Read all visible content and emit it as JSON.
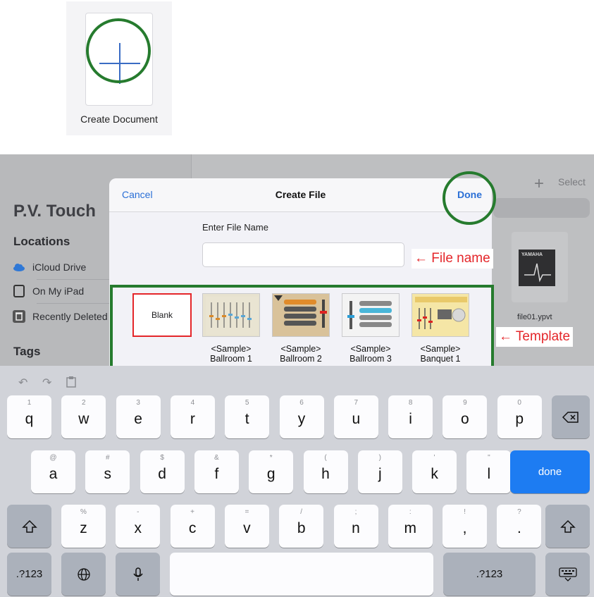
{
  "tile": {
    "label": "Create Document"
  },
  "background": {
    "app_title": "P.V. Touch",
    "locations_heading": "Locations",
    "locations": [
      "iCloud Drive",
      "On My iPad",
      "Recently Deleted"
    ],
    "tags_heading": "Tags",
    "select_label": "Select",
    "file_name": "file01.ypvt",
    "file_brand": "YAMAHA"
  },
  "dialog": {
    "cancel": "Cancel",
    "title": "Create File",
    "done": "Done",
    "field_label": "Enter File Name",
    "field_value": "",
    "templates": [
      {
        "name": "Blank"
      },
      {
        "name": "<Sample>\nBallroom 1"
      },
      {
        "name": "<Sample>\nBallroom 2"
      },
      {
        "name": "<Sample>\nBallroom 3"
      },
      {
        "name": "<Sample>\nBanquet 1"
      }
    ]
  },
  "annotations": {
    "file_name": "← File name",
    "template": "← Template"
  },
  "colors": {
    "accent_blue": "#2a6fd6",
    "annotation_red": "#e4262a",
    "highlight_green": "#267b2e",
    "return_key_blue": "#1d7cf2"
  },
  "keyboard": {
    "toolbar_icons": [
      "undo-icon",
      "redo-icon",
      "clipboard-icon"
    ],
    "row1": [
      {
        "hint": "1",
        "key": "q"
      },
      {
        "hint": "2",
        "key": "w"
      },
      {
        "hint": "3",
        "key": "e"
      },
      {
        "hint": "4",
        "key": "r"
      },
      {
        "hint": "5",
        "key": "t"
      },
      {
        "hint": "6",
        "key": "y"
      },
      {
        "hint": "7",
        "key": "u"
      },
      {
        "hint": "8",
        "key": "i"
      },
      {
        "hint": "9",
        "key": "o"
      },
      {
        "hint": "0",
        "key": "p"
      }
    ],
    "row2": [
      {
        "hint": "@",
        "key": "a"
      },
      {
        "hint": "#",
        "key": "s"
      },
      {
        "hint": "$",
        "key": "d"
      },
      {
        "hint": "&",
        "key": "f"
      },
      {
        "hint": "*",
        "key": "g"
      },
      {
        "hint": "(",
        "key": "h"
      },
      {
        "hint": ")",
        "key": "j"
      },
      {
        "hint": "'",
        "key": "k"
      },
      {
        "hint": "\"",
        "key": "l"
      }
    ],
    "row3": [
      {
        "hint": "%",
        "key": "z"
      },
      {
        "hint": "-",
        "key": "x"
      },
      {
        "hint": "+",
        "key": "c"
      },
      {
        "hint": "=",
        "key": "v"
      },
      {
        "hint": "/",
        "key": "b"
      },
      {
        "hint": ";",
        "key": "n"
      },
      {
        "hint": ":",
        "key": "m"
      },
      {
        "hint": "!",
        "key": ","
      },
      {
        "hint": "?",
        "key": "."
      }
    ],
    "return_label": "done",
    "numbers_label": ".?123"
  }
}
